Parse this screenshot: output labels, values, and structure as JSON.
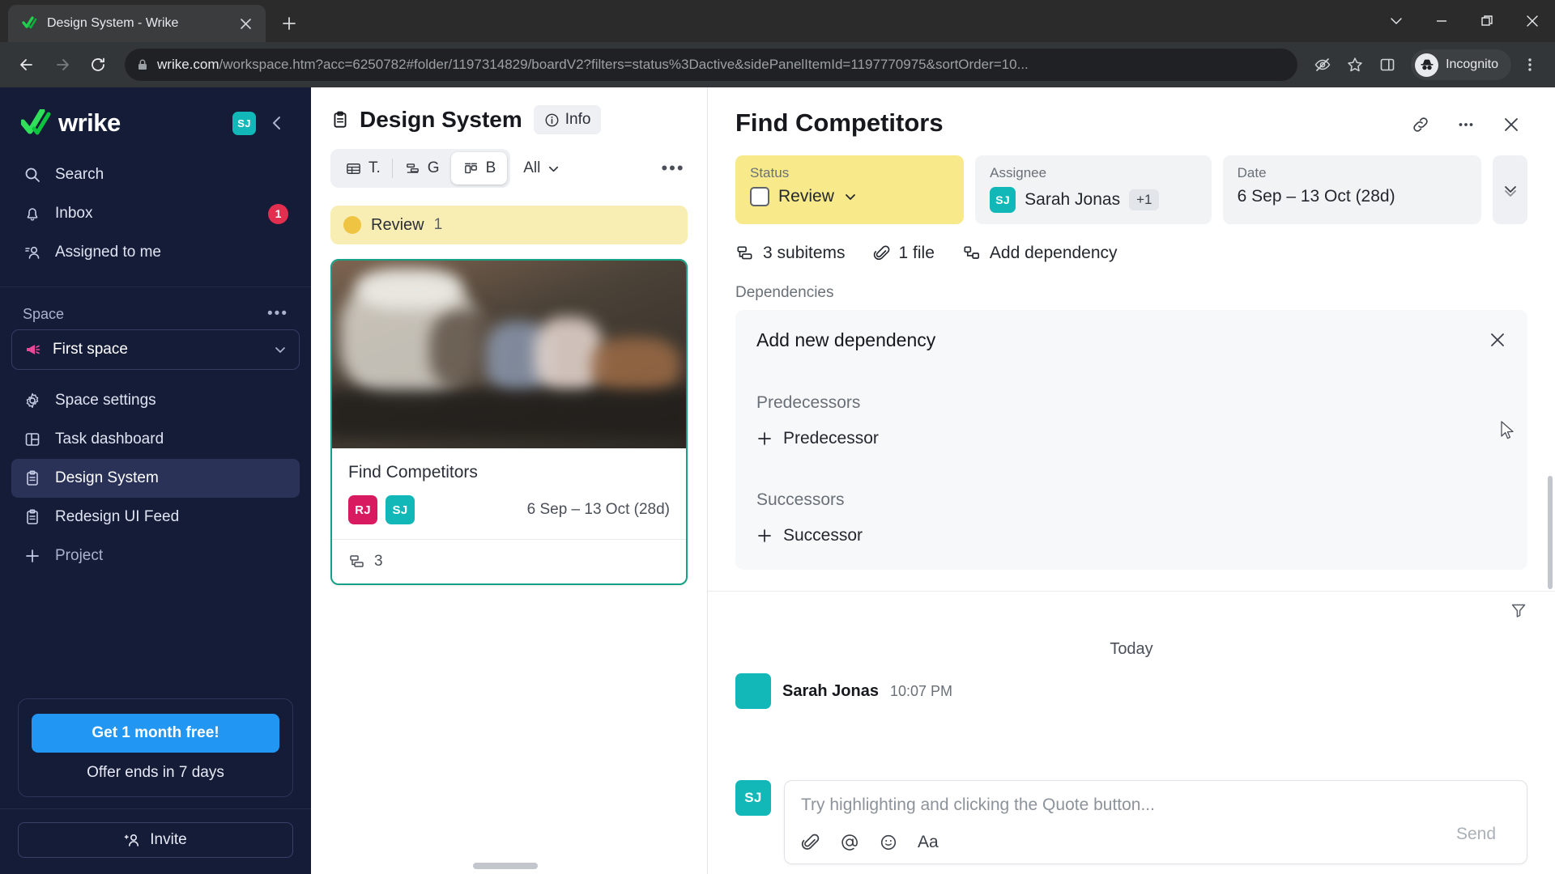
{
  "browser": {
    "tab_title": "Design System - Wrike",
    "new_tab_label": "+",
    "url_domain": "wrike.com",
    "url_path": "/workspace.htm?acc=6250782#folder/1197314829/boardV2?filters=status%3Dactive&sidePanelItemId=1197770975&sortOrder=10...",
    "profile_label": "Incognito"
  },
  "sidebar": {
    "brand": "wrike",
    "user_initials": "SJ",
    "nav": [
      {
        "label": "Search",
        "icon": "search-icon",
        "badge": ""
      },
      {
        "label": "Inbox",
        "icon": "bell-icon",
        "badge": "1"
      },
      {
        "label": "Assigned to me",
        "icon": "assigned-user-icon",
        "badge": ""
      }
    ],
    "section_label": "Space",
    "space_name": "First space",
    "items": [
      {
        "label": "Space settings",
        "icon": "gear-icon",
        "active": false
      },
      {
        "label": "Task dashboard",
        "icon": "dashboard-icon",
        "active": false
      },
      {
        "label": "Design System",
        "icon": "clipboard-icon",
        "active": true
      },
      {
        "label": "Redesign UI Feed",
        "icon": "clipboard-icon",
        "active": false
      },
      {
        "label": "Project",
        "icon": "plus-icon",
        "active": false
      }
    ],
    "promo_button": "Get 1 month free!",
    "promo_subtext": "Offer ends in 7 days",
    "invite_label": "Invite"
  },
  "board": {
    "title": "Design System",
    "info_label": "Info",
    "views": [
      {
        "label": "T.",
        "icon": "table-icon",
        "active": false
      },
      {
        "label": "G",
        "icon": "gantt-icon",
        "active": false
      },
      {
        "label": "B",
        "icon": "board-icon",
        "active": true
      }
    ],
    "filter_label": "All",
    "column": {
      "name": "Review",
      "count": "1"
    },
    "card": {
      "title": "Find Competitors",
      "assignees": [
        {
          "initials": "RJ",
          "color": "#d81b60"
        },
        {
          "initials": "SJ",
          "color": "#12b8b8"
        }
      ],
      "date": "6 Sep – 13 Oct (28d)",
      "subitem_count": "3"
    }
  },
  "detail": {
    "title": "Find Competitors",
    "status": {
      "label": "Status",
      "value": "Review"
    },
    "assignee": {
      "label": "Assignee",
      "value": "Sarah Jonas",
      "initials": "SJ",
      "extra": "+1"
    },
    "date": {
      "label": "Date",
      "value": "6 Sep – 13 Oct (28d)"
    },
    "meta": [
      {
        "label": "3 subitems",
        "icon": "subitems-icon"
      },
      {
        "label": "1 file",
        "icon": "paperclip-icon"
      },
      {
        "label": "Add dependency",
        "icon": "dependency-icon"
      }
    ],
    "dependencies": {
      "section_label": "Dependencies",
      "card_title": "Add new dependency",
      "predecessors_label": "Predecessors",
      "add_predecessor": "Predecessor",
      "successors_label": "Successors",
      "add_successor": "Successor"
    },
    "stream": {
      "date_divider": "Today",
      "comment_author": "Sarah Jonas",
      "comment_time": "10:07 PM"
    },
    "composer": {
      "avatar_initials": "SJ",
      "placeholder": "Try highlighting and clicking the Quote button...",
      "send_label": "Send",
      "tools": [
        "paperclip-icon",
        "mention-icon",
        "emoji-icon",
        "format-icon"
      ]
    }
  },
  "colors": {
    "sidebar_bg": "#151c37",
    "accent_green": "#16a085",
    "status_yellow": "#f8e98a",
    "teal_avatar": "#12b8b8",
    "pink_avatar": "#d81b60",
    "promo_blue": "#2196f3"
  }
}
